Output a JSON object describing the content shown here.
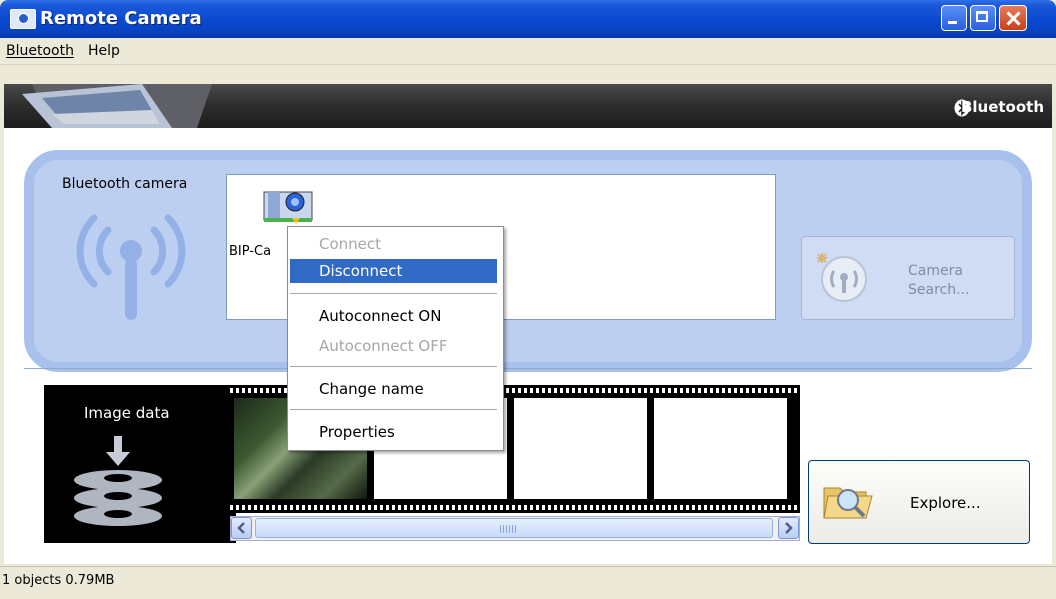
{
  "window": {
    "title": "Remote Camera"
  },
  "menubar": {
    "items": [
      {
        "label": "Bluetooth",
        "mnemonic": "B"
      },
      {
        "label": "Help",
        "mnemonic": "H"
      }
    ]
  },
  "banner": {
    "brand": "Bluetooth"
  },
  "camera_section": {
    "label": "Bluetooth camera",
    "device": {
      "name": "BIP-Ca",
      "icon": "camera-device-icon"
    },
    "search_button": {
      "line1": "Camera",
      "line2": "Search...",
      "enabled": false
    }
  },
  "context_menu": {
    "items": [
      {
        "label": "Connect",
        "enabled": false
      },
      {
        "label": "Disconnect",
        "enabled": true,
        "selected": true
      },
      {
        "label": "Autoconnect ON",
        "enabled": true
      },
      {
        "label": "Autoconnect OFF",
        "enabled": false
      },
      {
        "label": "Change name",
        "enabled": true
      },
      {
        "label": "Properties",
        "enabled": true
      }
    ]
  },
  "image_section": {
    "label": "Image data"
  },
  "explore_button": {
    "label": "Explore..."
  },
  "statusbar": {
    "text": "1 objects 0.79MB"
  },
  "colors": {
    "selection": "#316AC5",
    "panel": "#BCCFF0",
    "titlebar": "#0A49D0"
  }
}
